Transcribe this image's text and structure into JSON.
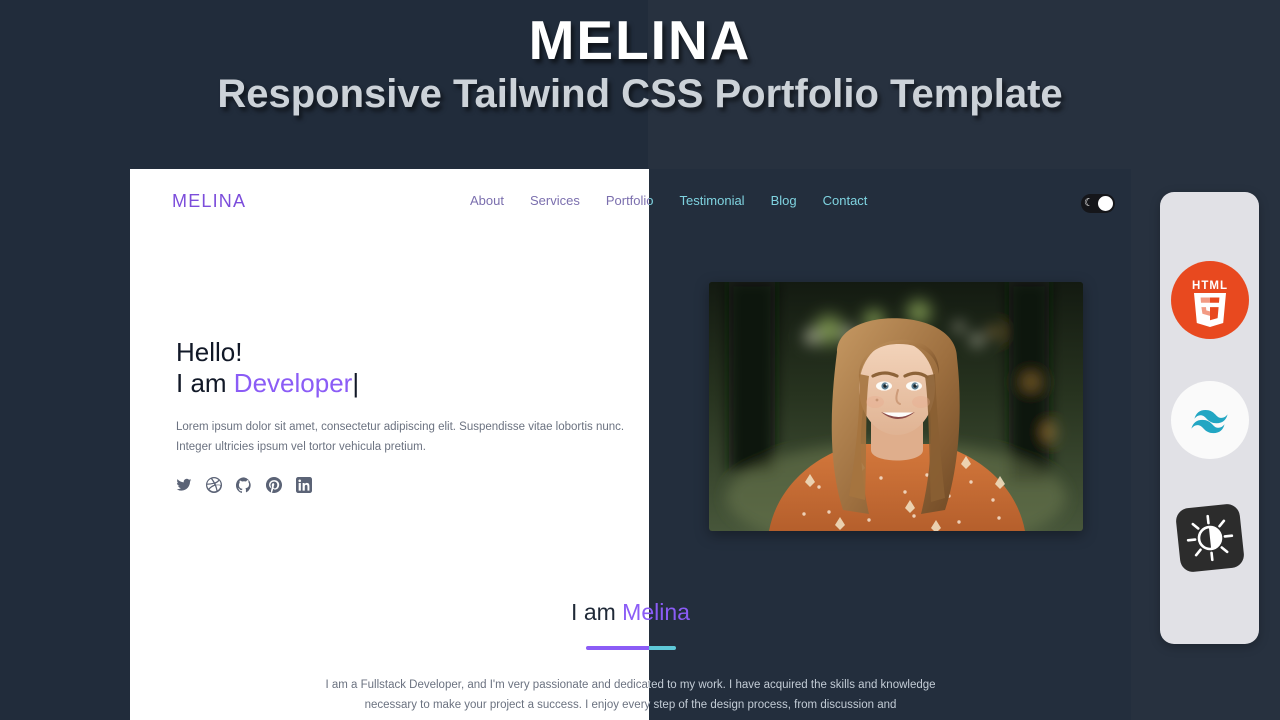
{
  "promo": {
    "title": "MELINA",
    "subtitle": "Responsive Tailwind CSS Portfolio Template"
  },
  "site": {
    "logo": "MELINA",
    "nav": [
      {
        "label": "About"
      },
      {
        "label": "Services"
      },
      {
        "label": "Portfolio"
      },
      {
        "label": "Testimonial"
      },
      {
        "label": "Blog"
      },
      {
        "label": "Contact"
      }
    ],
    "theme_toggle": {
      "icon": "moon-icon",
      "state": "on"
    },
    "hero": {
      "greeting": "Hello!",
      "line_prefix": "I am ",
      "typed_word": "Developer",
      "caret": "|",
      "paragraph": "Lorem ipsum dolor sit amet, consectetur adipiscing elit. Suspendisse vitae lobortis nunc. Integer ultricies ipsum vel tortor vehicula pretium.",
      "socials": [
        {
          "name": "twitter-icon"
        },
        {
          "name": "dribbble-icon"
        },
        {
          "name": "github-icon"
        },
        {
          "name": "pinterest-icon"
        },
        {
          "name": "linkedin-icon"
        }
      ],
      "portrait_alt": "Smiling woman in orange patterned top, blurred park background"
    },
    "about": {
      "heading_prefix": "I am ",
      "heading_name": "Melina",
      "paragraph": "I am a Fullstack Developer, and I'm very passionate and dedicated to my work. I have acquired the skills and knowledge necessary to make your project a success. I enjoy every step of the design process, from discussion and"
    }
  },
  "tech_rail": [
    {
      "name": "html5-badge",
      "label": "HTML"
    },
    {
      "name": "tailwindcss-badge",
      "label": "Tailwind CSS"
    },
    {
      "name": "darkmode-badge",
      "label": "Dark Mode"
    }
  ],
  "colors": {
    "page_bg": "#212c3b",
    "page_bg_right": "#27313f",
    "accent_purple": "#8b5cf6",
    "accent_teal": "#5ec8d8",
    "light_bg": "#ffffff",
    "dark_bg": "#232e3d",
    "html5_orange": "#e44d26",
    "tailwind_teal": "#22a6c3"
  }
}
